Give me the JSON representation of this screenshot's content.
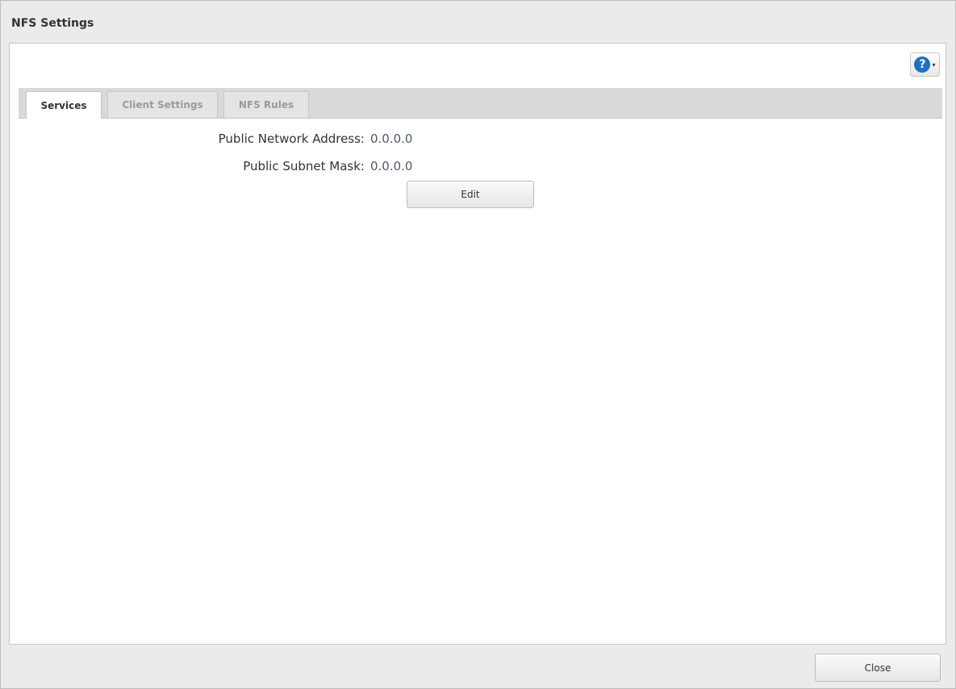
{
  "window": {
    "title": "NFS Settings"
  },
  "help": {
    "icon": "help-icon",
    "glyph": "?",
    "caret": "▾",
    "accent_color": "#1e6fc7"
  },
  "tabs": [
    {
      "label": "Services",
      "active": true
    },
    {
      "label": "Client Settings",
      "active": false
    },
    {
      "label": "NFS Rules",
      "active": false
    }
  ],
  "services": {
    "public_network_address_label": "Public Network Address:",
    "public_network_address_value": "0.0.0.0",
    "public_subnet_mask_label": "Public Subnet Mask:",
    "public_subnet_mask_value": "0.0.0.0",
    "edit_label": "Edit"
  },
  "footer": {
    "close_label": "Close"
  }
}
